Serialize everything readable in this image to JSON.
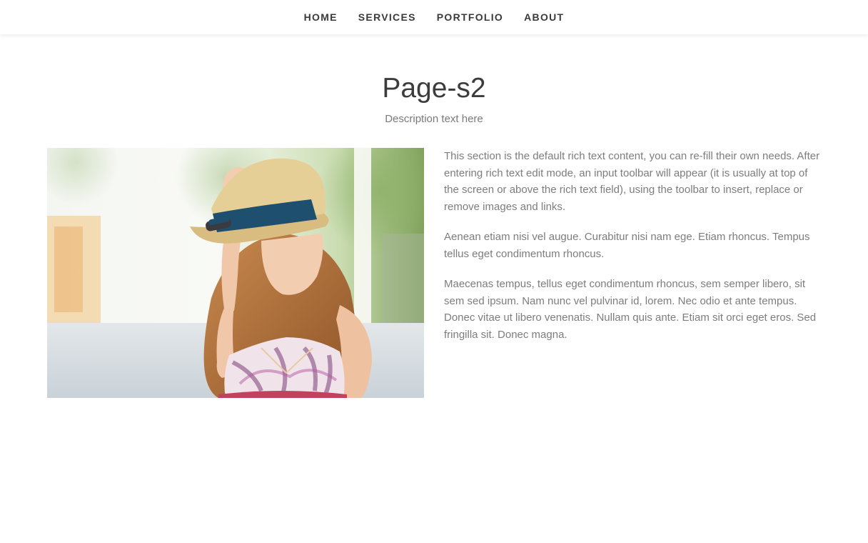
{
  "nav": {
    "items": [
      {
        "label": "HOME"
      },
      {
        "label": "SERVICES"
      },
      {
        "label": "PORTFOLIO"
      },
      {
        "label": "ABOUT"
      }
    ]
  },
  "header": {
    "title": "Page-s2",
    "description": "Description text here"
  },
  "content": {
    "paragraphs": [
      "This section is the default rich text content, you can re-fill their own needs. After entering rich text edit mode, an input toolbar will appear (it is usually at top of the screen or above the rich text field), using the toolbar to insert, replace or remove images and links.",
      "Aenean etiam nisi vel augue. Curabitur nisi nam ege. Etiam rhoncus. Tempus tellus eget condimentum rhoncus.",
      "Maecenas tempus, tellus eget condimentum rhoncus, sem semper libero, sit sem sed ipsum. Nam nunc vel pulvinar id, lorem. Nec odio et ante tempus. Donec vitae ut libero venenatis. Nullam quis ante. Etiam sit orci eget eros. Sed fringilla sit. Donec magna."
    ]
  },
  "colors": {
    "nav_text": "#3a3a3a",
    "title": "#3c3c3c",
    "body_text": "#7d7d7d",
    "hat_band": "#1f4f6e"
  }
}
